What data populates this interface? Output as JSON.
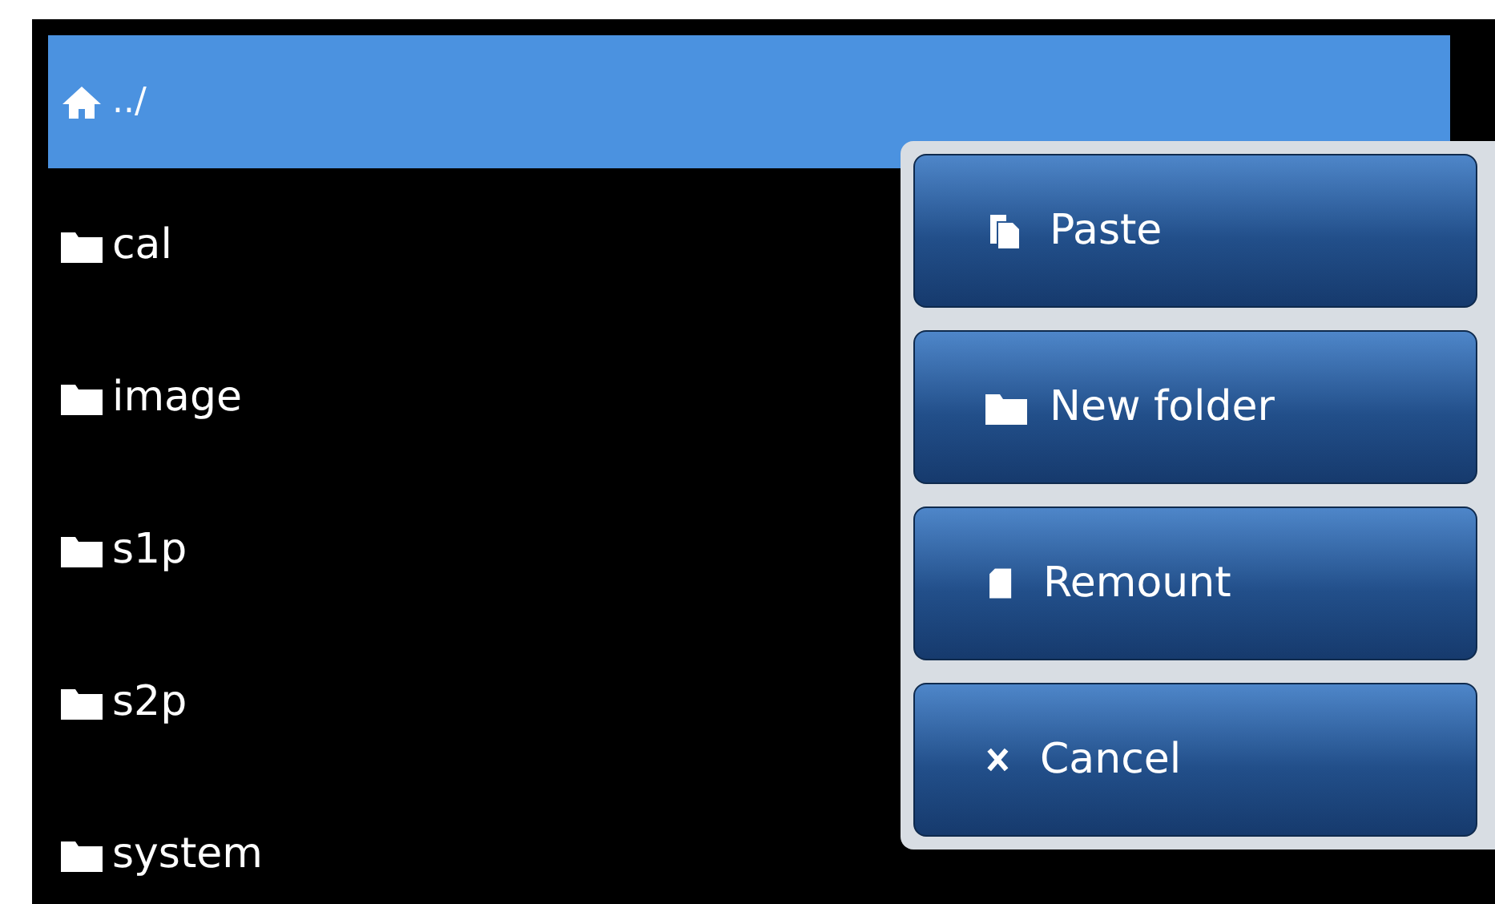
{
  "header": {
    "label": "../",
    "selected": true
  },
  "items": [
    {
      "label": "cal",
      "selected": false
    },
    {
      "label": "image",
      "selected": false
    },
    {
      "label": "s1p",
      "selected": false
    },
    {
      "label": "s2p",
      "selected": false
    },
    {
      "label": "system",
      "selected": false
    }
  ],
  "menu": [
    {
      "kind": "paste",
      "label": "Paste"
    },
    {
      "kind": "folder",
      "label": "New folder"
    },
    {
      "kind": "remount",
      "label": "Remount"
    },
    {
      "kind": "cancel",
      "label": "Cancel"
    }
  ]
}
